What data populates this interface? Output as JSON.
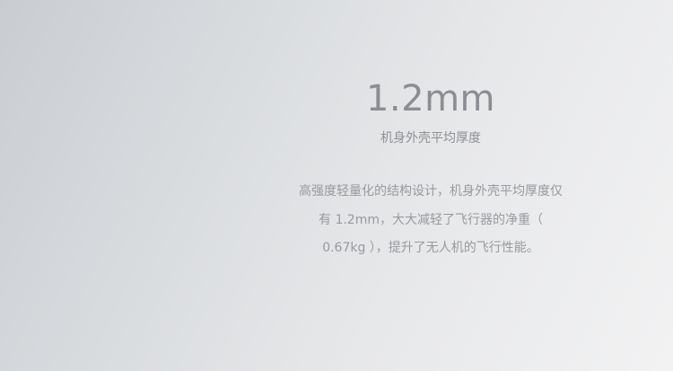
{
  "feature": {
    "metric": "1.2mm",
    "metric_label": "机身外壳平均厚度",
    "description": "高强度轻量化的结构设计，机身外壳平均厚度仅有 1.2mm，大大减轻了飞行器的净重（ 0.67kg ），提升了无人机的飞行性能。"
  }
}
